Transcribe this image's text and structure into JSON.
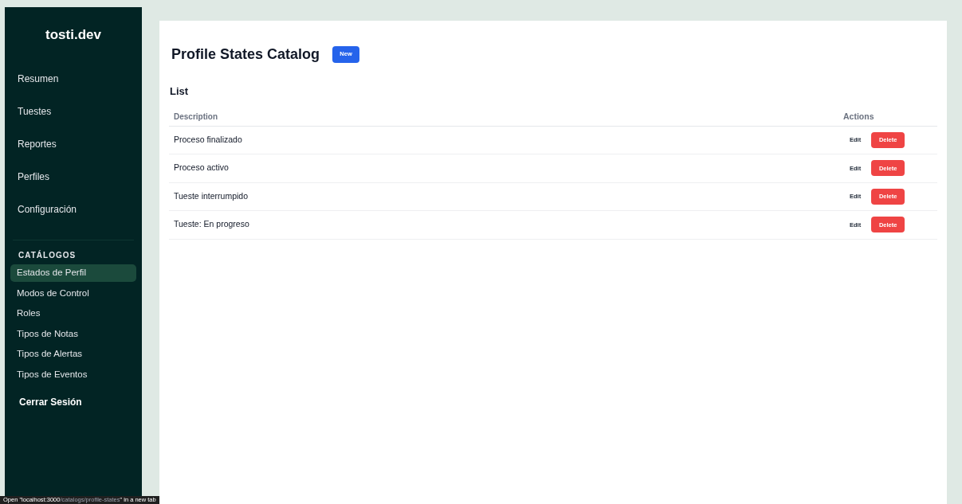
{
  "sidebar": {
    "brand": "tosti.dev",
    "nav": [
      {
        "label": "Resumen"
      },
      {
        "label": "Tuestes"
      },
      {
        "label": "Reportes"
      },
      {
        "label": "Perfiles"
      },
      {
        "label": "Configuración"
      }
    ],
    "section_title": "CATÁLOGOS",
    "catalogs": [
      {
        "label": "Estados de Perfil",
        "selected": true
      },
      {
        "label": "Modos de Control",
        "selected": false
      },
      {
        "label": "Roles",
        "selected": false
      },
      {
        "label": "Tipos de Notas",
        "selected": false
      },
      {
        "label": "Tipos de Alertas",
        "selected": false
      },
      {
        "label": "Tipos de Eventos",
        "selected": false
      }
    ],
    "logout": "Cerrar Sesión"
  },
  "main": {
    "title": "Profile States Catalog",
    "new_button": "New",
    "list_title": "List",
    "table": {
      "columns": [
        "Description",
        "Actions"
      ],
      "rows": [
        {
          "description": "Proceso finalizado",
          "edit": "Edit",
          "delete": "Delete"
        },
        {
          "description": "Proceso activo",
          "edit": "Edit",
          "delete": "Delete"
        },
        {
          "description": "Tueste interrumpido",
          "edit": "Edit",
          "delete": "Delete"
        },
        {
          "description": "Tueste: En progreso",
          "edit": "Edit",
          "delete": "Delete"
        }
      ]
    }
  },
  "status_bar": {
    "parts": [
      "Open \"localhost:3000",
      "/catalogs/profile-states",
      "\" in a new tab"
    ]
  }
}
